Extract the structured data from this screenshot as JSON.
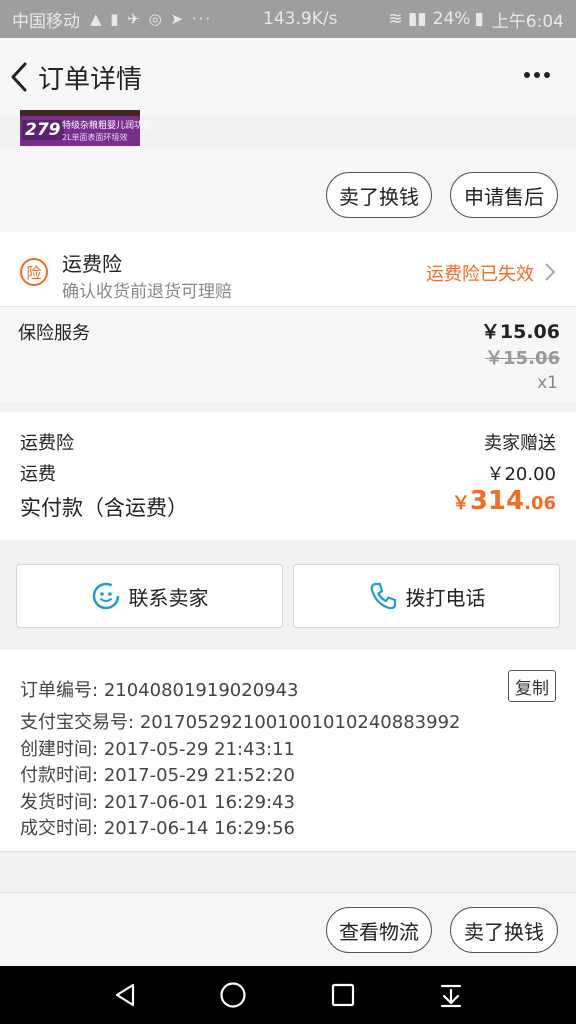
{
  "status_bar": {
    "carrier": "中国移动",
    "speed": "143.9K/s",
    "battery": "24%",
    "time": "上午6:04"
  },
  "nav": {
    "title": "订单详情"
  },
  "banner": {
    "price": "279",
    "text": "特级杂粮粗婴儿润功能",
    "subtext": "2L单面表面环境效"
  },
  "top_actions": {
    "sell_label": "卖了换钱",
    "after_sale_label": "申请售后"
  },
  "insurance": {
    "badge": "险",
    "title": "运费险",
    "subtitle": "确认收货前退货可理赔",
    "status": "运费险已失效"
  },
  "service": {
    "title": "保险服务",
    "price": "￥15.06",
    "original_price": "￥15.06",
    "quantity": "x1"
  },
  "payment": {
    "freight_insurance_label": "运费险",
    "freight_insurance_value": "卖家赠送",
    "shipping_label": "运费",
    "shipping_value": "￥20.00",
    "total_label": "实付款（含运费）",
    "total_currency": "￥",
    "total_integer": "314",
    "total_decimal": ".06"
  },
  "contact": {
    "seller_label": "联系卖家",
    "call_label": "拨打电话"
  },
  "order_info": {
    "order_no_label": "订单编号:",
    "order_no": "21040801919020943",
    "copy_label": "复制",
    "alipay_label": "支付宝交易号:",
    "alipay_no": "2017052921001001010240883992",
    "created_label": "创建时间:",
    "created_time": "2017-05-29 21:43:11",
    "paid_label": "付款时间:",
    "paid_time": "2017-05-29 21:52:20",
    "shipped_label": "发货时间:",
    "shipped_time": "2017-06-01 16:29:43",
    "completed_label": "成交时间:",
    "completed_time": "2017-06-14 16:29:56"
  },
  "bottom_actions": {
    "logistics_label": "查看物流",
    "sell_label": "卖了换钱"
  },
  "colors": {
    "accent": "#f36c21",
    "link_blue": "#1e9bd7"
  }
}
